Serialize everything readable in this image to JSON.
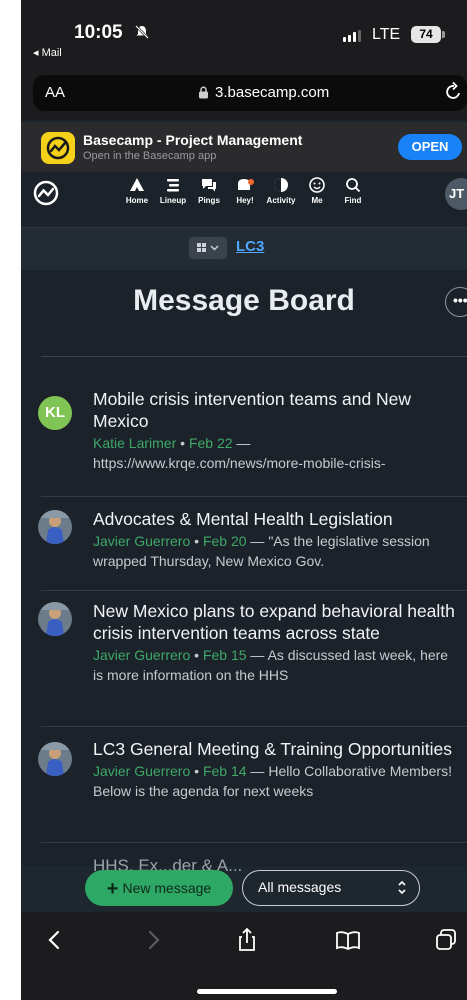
{
  "status_bar": {
    "time": "10:05",
    "back_app": "◂ Mail",
    "network": "LTE",
    "battery": "74"
  },
  "browser": {
    "text_size_label": "AA",
    "domain": "3.basecamp.com"
  },
  "app_banner": {
    "title": "Basecamp - Project Management",
    "subtitle": "Open in the Basecamp app",
    "open_label": "OPEN"
  },
  "nav": {
    "items": [
      {
        "label": "Home",
        "icon": "home-icon"
      },
      {
        "label": "Lineup",
        "icon": "lineup-icon"
      },
      {
        "label": "Pings",
        "icon": "pings-icon"
      },
      {
        "label": "Hey!",
        "icon": "hey-icon"
      },
      {
        "label": "Activity",
        "icon": "activity-icon"
      },
      {
        "label": "Me",
        "icon": "me-icon"
      },
      {
        "label": "Find",
        "icon": "find-icon"
      }
    ],
    "user_initials": "JT"
  },
  "project": {
    "name": "LC3"
  },
  "board": {
    "title": "Message Board",
    "more_label": "•••"
  },
  "messages": [
    {
      "avatar_initials": "KL",
      "subject": "Mobile crisis intervention teams and New Mexico",
      "author": "Katie Larimer",
      "date": "Feb 22",
      "excerpt": "https://www.krqe.com/news/more-mobile-crisis-"
    },
    {
      "avatar_initials": "",
      "subject": "Advocates & Mental Health Legislation",
      "author": "Javier Guerrero",
      "date": "Feb 20",
      "excerpt": "\"As the legislative session wrapped Thursday, New Mexico Gov."
    },
    {
      "avatar_initials": "",
      "subject": "New Mexico plans to expand behavioral health crisis intervention teams across state",
      "author": "Javier Guerrero",
      "date": "Feb 15",
      "excerpt": "As discussed last week, here is more information on the HHS"
    },
    {
      "avatar_initials": "",
      "subject": "LC3 General Meeting & Training Opportunities",
      "author": "Javier Guerrero",
      "date": "Feb 14",
      "excerpt": "Hello Collaborative Members! Below is the agenda for next weeks"
    }
  ],
  "peek_text": "HHS, Ex...der & A...",
  "actions": {
    "new_message_label": "New message",
    "filter_selected": "All messages"
  },
  "colors": {
    "background": "#1c2229",
    "accent_green": "#2ea865",
    "link_blue": "#4ea7ff",
    "ios_blue": "#1a82f7"
  }
}
